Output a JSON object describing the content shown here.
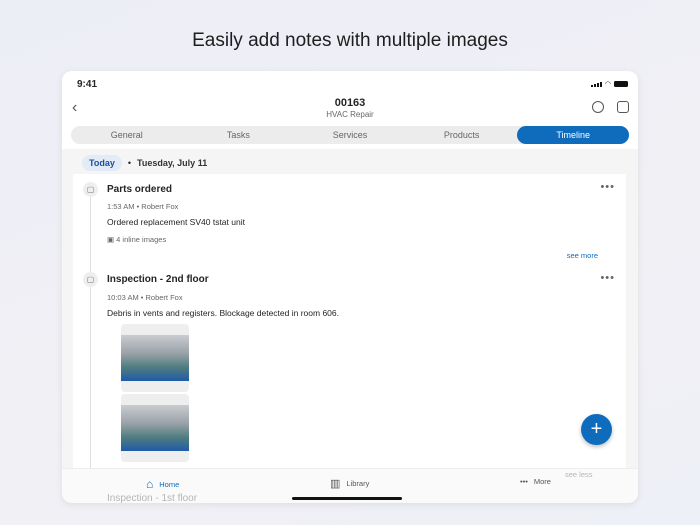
{
  "headline": "Easily add notes with multiple images",
  "status": {
    "time": "9:41"
  },
  "header": {
    "title": "00163",
    "subtitle": "HVAC Repair"
  },
  "tabs": [
    {
      "label": "General"
    },
    {
      "label": "Tasks"
    },
    {
      "label": "Services"
    },
    {
      "label": "Products"
    },
    {
      "label": "Timeline",
      "active": true
    }
  ],
  "date": {
    "badge": "Today",
    "separator": "•",
    "label": "Tuesday, July 11"
  },
  "entries": [
    {
      "title": "Parts ordered",
      "meta": "1:53 AM • Robert Fox",
      "body": "Ordered replacement SV40 tstat unit",
      "images": "4 inline images",
      "link": "see more"
    },
    {
      "title": "Inspection - 2nd floor",
      "meta": "10:03 AM • Robert Fox",
      "body": "Debris in vents and registers.  Blockage detected in room 606.",
      "link": "see less"
    },
    {
      "title": "Inspection - 1st floor"
    }
  ],
  "fab": "+",
  "bottom_nav": [
    {
      "label": "Home",
      "active": true
    },
    {
      "label": "Library"
    },
    {
      "label": "More"
    }
  ],
  "colors": {
    "accent": "#0f6cbd"
  }
}
